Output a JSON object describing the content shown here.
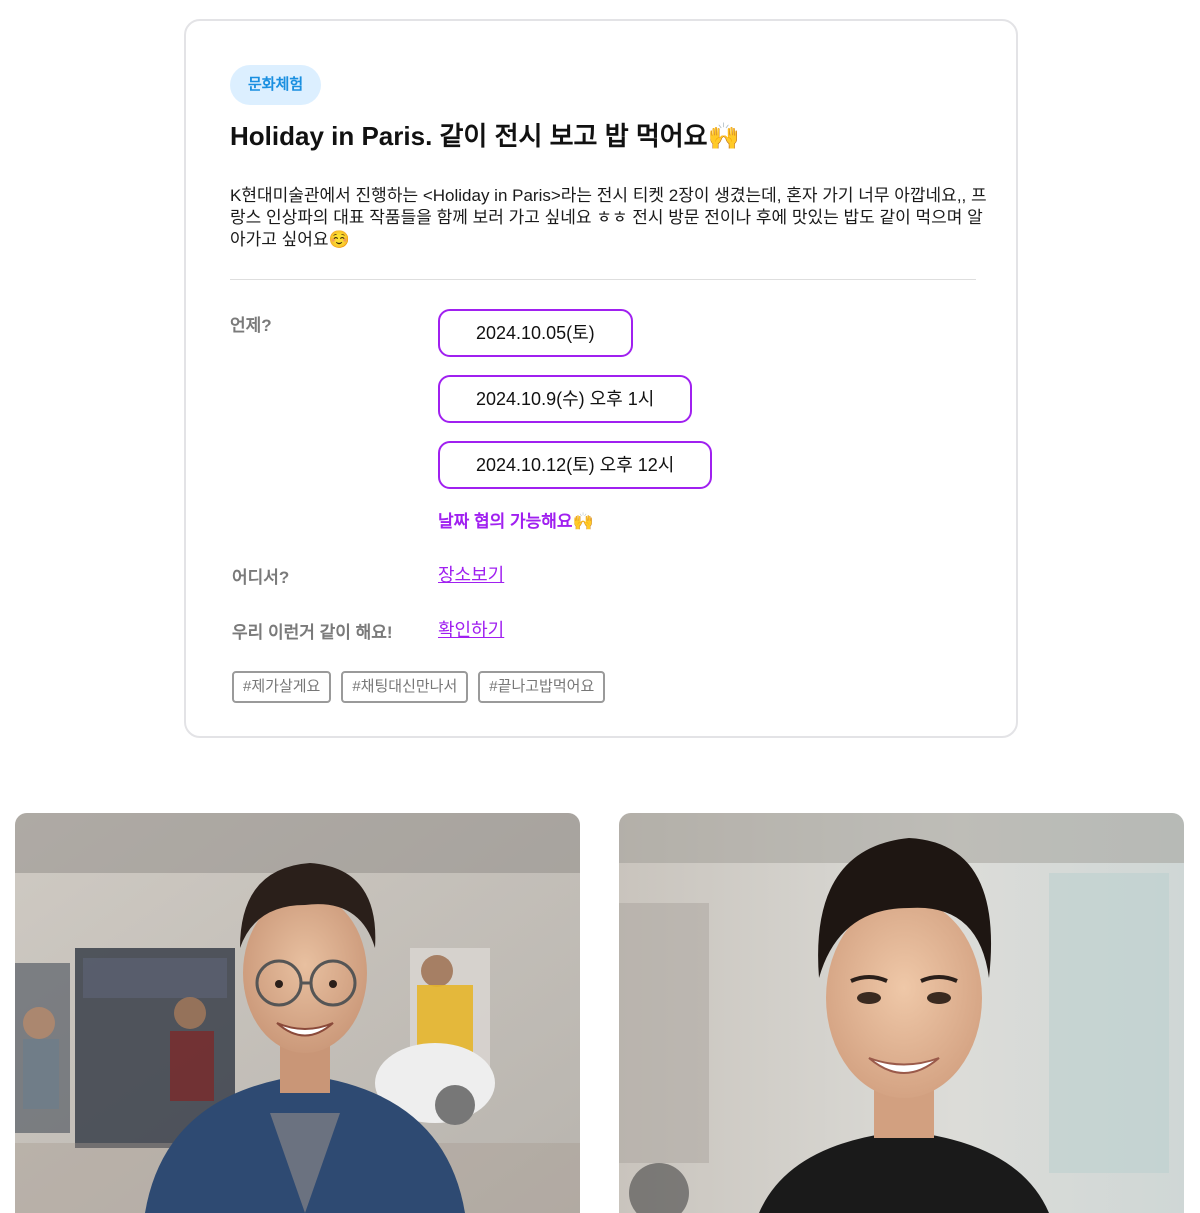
{
  "post": {
    "category": "문화체험",
    "title": "Holiday in Paris. 같이 전시 보고 밥 먹어요🙌",
    "description": "K현대미술관에서 진행하는 <Holiday in Paris>라는 전시 티켓 2장이 생겼는데, 혼자 가기 너무 아깝네요,, 프랑스 인상파의 대표 작품들을 함께 보러 가고 싶네요 ㅎㅎ 전시 방문 전이나 후에 맛있는 밥도 같이 먹으며 알아가고 싶어요☺️"
  },
  "details": {
    "when_label": "언제?",
    "dates": [
      "2024.10.05(토)",
      "2024.10.9(수) 오후 1시",
      "2024.10.12(토) 오후 12시"
    ],
    "date_note": "날짜 협의 가능해요🙌",
    "where_label": "어디서?",
    "where_link": "장소보기",
    "activity_label": "우리 이런거 같이 해요!",
    "activity_link": "확인하기"
  },
  "tags": [
    "#제가살게요",
    "#채팅대신만나서",
    "#끝나고밥먹어요"
  ],
  "profiles": [
    {
      "name": "profile-photo-glasses",
      "icon": "person-photo"
    },
    {
      "name": "profile-photo-smiling",
      "icon": "person-photo"
    }
  ],
  "colors": {
    "accent": "#a020f0",
    "badge_bg": "#dcefff",
    "badge_text": "#1a8fe0"
  }
}
